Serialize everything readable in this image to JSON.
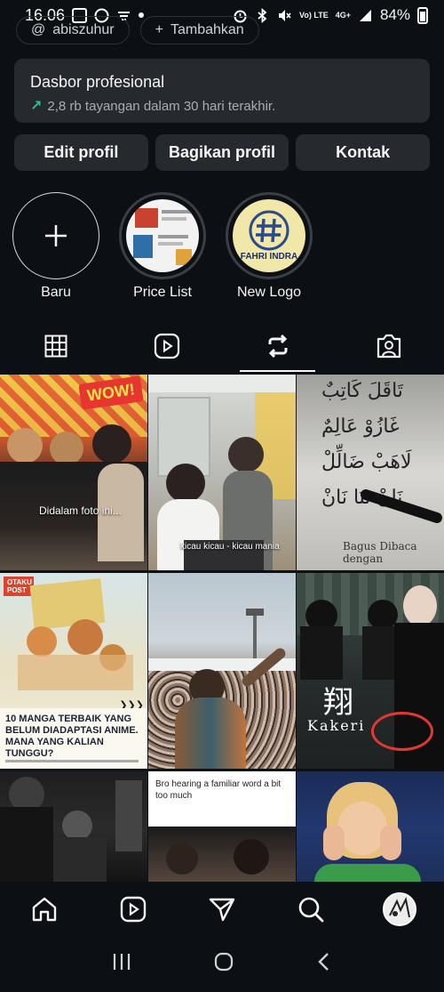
{
  "status": {
    "time": "16.06",
    "network": "Vo) LTE",
    "signal": "4G+",
    "battery": "84%"
  },
  "chips": {
    "handle": "abiszuhur",
    "add": "Tambahkan"
  },
  "dashboard": {
    "title": "Dasbor profesional",
    "subtitle": "2,8 rb tayangan dalam 30 hari terakhir."
  },
  "buttons": {
    "edit": "Edit profil",
    "share": "Bagikan profil",
    "contact": "Kontak"
  },
  "highlights": [
    {
      "label": "Baru"
    },
    {
      "label": "Price List"
    },
    {
      "label": "New Logo",
      "logo_text": "FAHRI INDRA"
    }
  ],
  "tabs": [
    "grid-icon",
    "reels-icon",
    "reposts-icon",
    "tagged-icon"
  ],
  "posts": [
    {
      "caption": "Didalam foto ini...",
      "badge": "WOW!"
    },
    {
      "caption": "kicau kicau - kicau mania"
    },
    {
      "caption": "Bagus Dibaca dengan"
    },
    {
      "brand": "OTAKU POST",
      "caption": "10 MANGA TERBAIK YANG BELUM DIADAPTASI ANIME. MANA YANG KALIAN TUNGGU?"
    },
    {
      "caption": ""
    },
    {
      "caption": "翔",
      "sub": "Kakeri"
    },
    {
      "caption": ""
    },
    {
      "caption": "Bro hearing a familiar word a bit too much"
    },
    {
      "caption": ""
    }
  ],
  "colors": {
    "background": "#0c1014",
    "card": "#262a2f",
    "accent_green": "#27c489"
  }
}
